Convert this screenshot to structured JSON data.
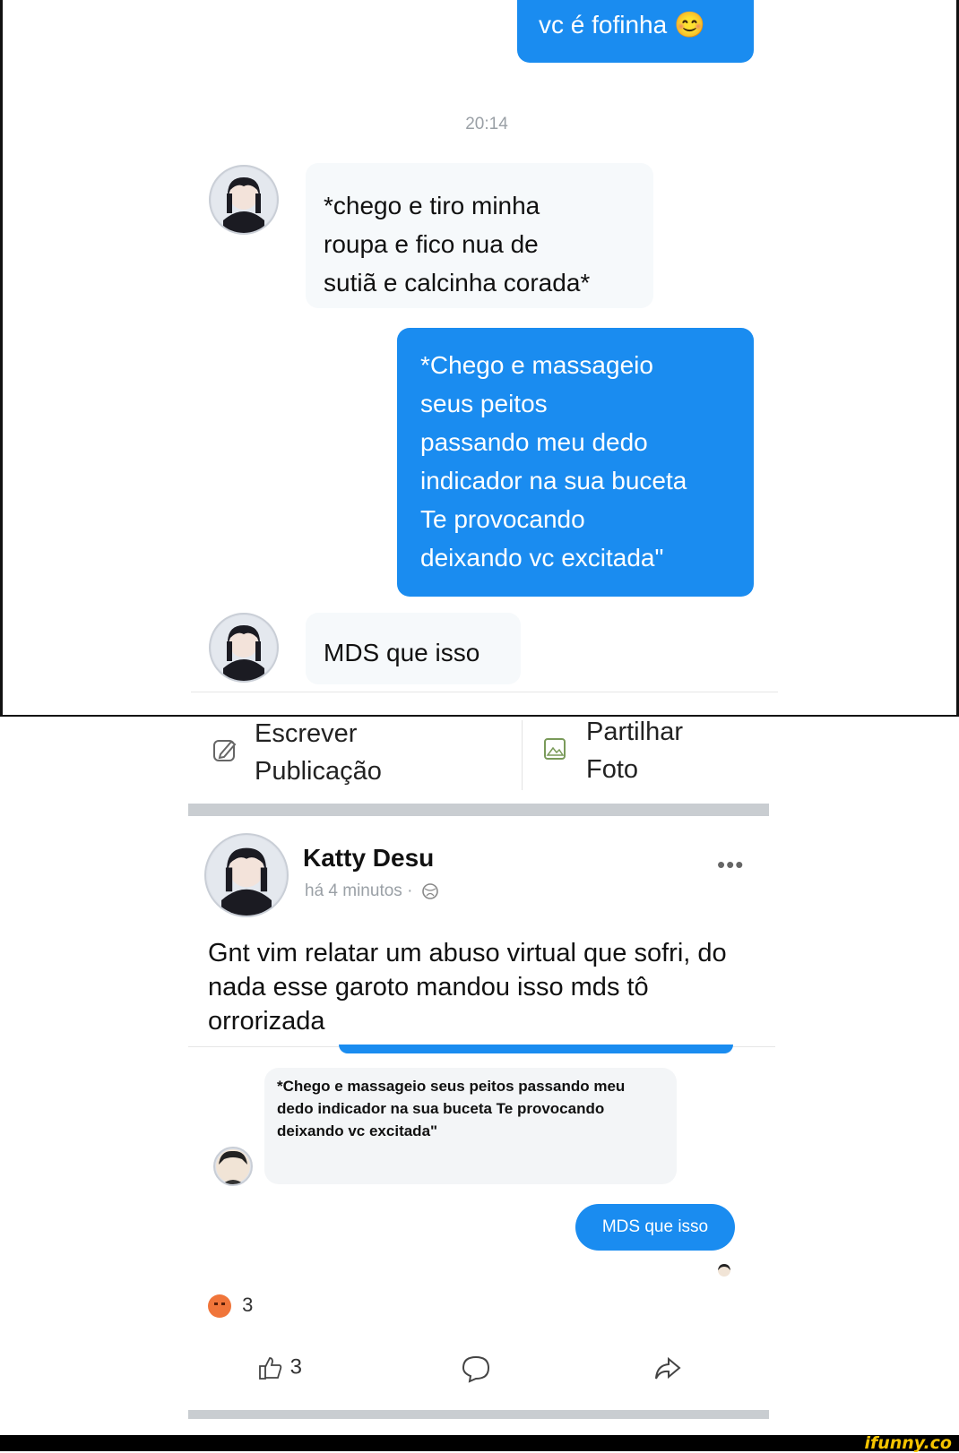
{
  "chat": {
    "out_1": "vc é fofinha 😊",
    "timestamp": "20:14",
    "in_1": [
      "*chego e tiro minha",
      "roupa e fico nua de",
      "sutiã e calcinha corada*"
    ],
    "out_2": [
      "*Chego e massageio",
      "seus peitos",
      "passando meu dedo",
      "indicador na sua buceta",
      "Te provocando",
      "deixando vc excitada\""
    ],
    "in_2": "MDS que isso"
  },
  "composer": {
    "write_line1": "Escrever",
    "write_line2": "Publicação",
    "share_line1": "Partilhar",
    "share_line2": "Foto"
  },
  "post": {
    "author": "Katty Desu",
    "time": "há 4 minutos ·",
    "more": "•••",
    "text": "Gnt vim relatar um abuso virtual que sofri, do nada esse garoto mandou isso mds tô orrorizada",
    "embedded_in": "*Chego e massageio seus peitos passando meu dedo indicador na sua buceta Te provocando deixando vc excitada\"",
    "embedded_out": "MDS que isso",
    "reaction_count": "3",
    "like_count": "3"
  },
  "watermark": "ifunny.co",
  "colors": {
    "bubble_blue": "#1a8cf0",
    "reaction_angry": "#f0753a"
  }
}
